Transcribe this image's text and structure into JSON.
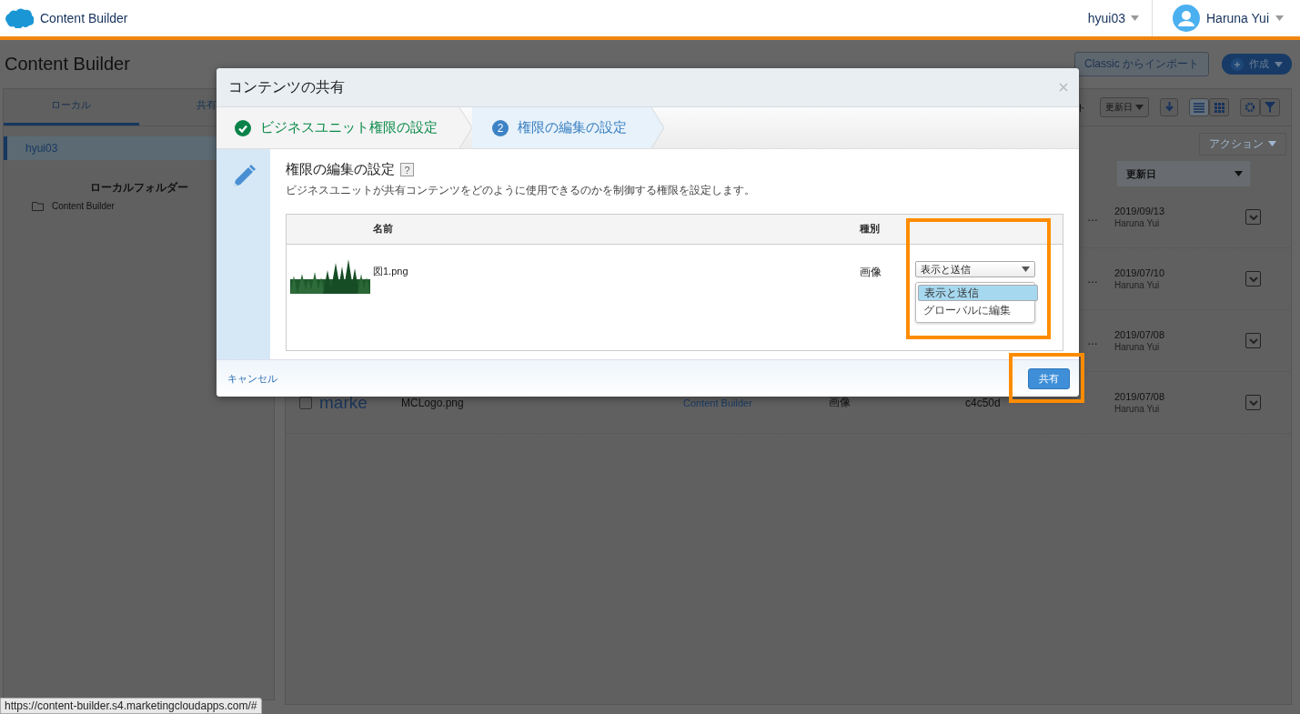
{
  "header": {
    "app_name": "Content Builder",
    "business_unit": "hyui03",
    "user_name": "Haruna Yui"
  },
  "page": {
    "title": "Content Builder",
    "import_button": "Classic からインポート",
    "create_button": "作成"
  },
  "sidebar": {
    "tabs": [
      {
        "label": "ローカル",
        "selected": true
      },
      {
        "label": "共有",
        "selected": false
      }
    ],
    "business_units": [
      {
        "label": "hyui03",
        "selected": true
      }
    ],
    "section_title": "ローカルフォルダー",
    "folders": [
      {
        "label": "Content Builder"
      }
    ]
  },
  "toolbar": {
    "cut_text": "ト",
    "sort_button": "更新日",
    "action_button": "アクション"
  },
  "table": {
    "column_date": "更新日",
    "rows": [
      {
        "kind": "partial",
        "id": "…",
        "date": "2019/09/13",
        "user": "Haruna Yui"
      },
      {
        "kind": "partial",
        "id": "…",
        "date": "2019/07/10",
        "user": "Haruna Yui"
      },
      {
        "kind": "partial",
        "id": "…",
        "date": "2019/07/08",
        "user": "Haruna Yui"
      },
      {
        "kind": "full",
        "checked": false,
        "logo_text": "marke",
        "name": "MCLogo.png",
        "location": "Content Builder",
        "type": "画像",
        "id": "c4c50d",
        "date": "2019/07/08",
        "user": "Haruna Yui"
      }
    ]
  },
  "dialog": {
    "title": "コンテンツの共有",
    "steps": [
      {
        "label": "ビジネスユニット権限の設定",
        "done": true,
        "current": false
      },
      {
        "label": "権限の編集の設定",
        "number": "2",
        "done": false,
        "current": true
      }
    ],
    "heading": "権限の編集の設定",
    "help": "?",
    "description": "ビジネスユニットが共有コンテンツをどのように使用できるのかを制御する権限を設定します。",
    "columns": [
      "名前",
      "種別"
    ],
    "items": [
      {
        "kind": "picture",
        "name": "図1.png",
        "type": "画像",
        "permission": "表示と送信",
        "options": [
          {
            "label": "表示と送信",
            "selected": true
          },
          {
            "label": "グローバルに編集",
            "selected": false
          }
        ]
      }
    ],
    "cancel": "キャンセル",
    "share": "共有"
  },
  "status_bar": "https://content-builder.s4.marketingcloudapps.com/#"
}
